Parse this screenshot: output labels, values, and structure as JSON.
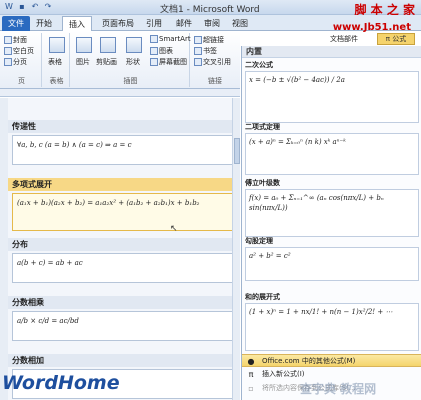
{
  "window": {
    "title": "文档1 - Microsoft Word"
  },
  "watermark": {
    "top": "脚 本 之 家",
    "url": "www.Jb51.net",
    "bottom": "查字典 教程网"
  },
  "logo": "WordHome",
  "tabs": [
    "文件",
    "开始",
    "插入",
    "页面布局",
    "引用",
    "邮件",
    "审阅",
    "视图"
  ],
  "ribbon": {
    "pages": [
      "封面",
      "空白页",
      "分页"
    ],
    "table_group": "表格",
    "illustrations": [
      "图片",
      "剪贴画",
      "形状"
    ],
    "smart": [
      "SmartArt",
      "图表",
      "屏幕截图"
    ],
    "links": [
      "超链接",
      "书签",
      "交叉引用"
    ],
    "groups": [
      "页",
      "表格",
      "插图",
      "链接"
    ],
    "docpart": "文档部件",
    "formula_button": "π 公式"
  },
  "gallery": {
    "sections": [
      {
        "title": "传递性",
        "formula": "∀a, b, c (a = b) ∧ (a = c) ⇒ a = c"
      },
      {
        "title": "多项式展开",
        "formula": "(a₁x + b₁)(a₂x + b₂) = a₁a₂x² + (a₁b₂ + a₂b₁)x + b₁b₂"
      },
      {
        "title": "分布",
        "formula": "a(b + c) = ab + ac"
      },
      {
        "title": "分数相乘",
        "formula": "a/b × c/d = ac/bd"
      },
      {
        "title": "分数相加",
        "formula": ""
      }
    ]
  },
  "panel": {
    "header": "内置",
    "items": [
      {
        "name": "二次公式",
        "formula": "x = (−b ± √(b² − 4ac)) / 2a"
      },
      {
        "name": "二项式定理",
        "formula": "(x + a)ⁿ = Σₖ₌₀ⁿ (n k) xᵏ aⁿ⁻ᵏ"
      },
      {
        "name": "傅立叶级数",
        "formula": "f(x) = a₀ + Σₙ₌₁^∞ (aₙ cos(nπx/L) + bₙ sin(nπx/L))"
      },
      {
        "name": "勾股定理",
        "formula": "a² + b² = c²"
      },
      {
        "name": "和的展开式",
        "formula": "(1 + x)ⁿ = 1 + nx/1! + n(n − 1)x²/2! + ⋯"
      }
    ],
    "footer": [
      "Office.com 中的其他公式(M)",
      "插入新公式(I)",
      "将所选内容保存到公式库(S)..."
    ]
  },
  "colors": {
    "accent": "#2a6ac0",
    "highlight": "#f4d46c",
    "logo": "#1e4f9e",
    "watermark": "#cc0000"
  }
}
